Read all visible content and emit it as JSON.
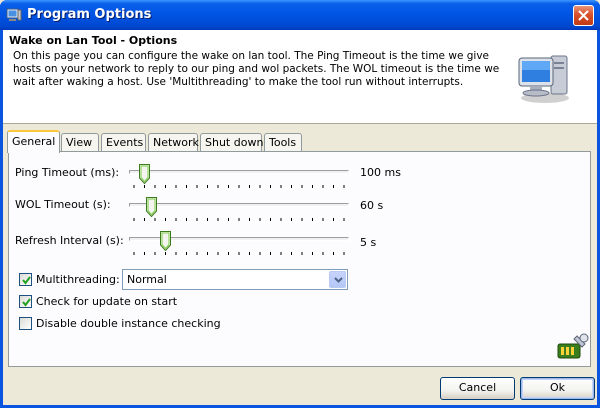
{
  "window": {
    "title": "Program Options"
  },
  "header": {
    "title": "Wake on Lan Tool - Options",
    "description": "On this page you can configure the wake on lan tool. The Ping Timeout is the time we give hosts on your network to reply to our ping and wol packets. The WOL timeout is the time we wait after waking a host. Use 'Multithreading' to make the tool run without interrupts."
  },
  "tabs": [
    {
      "label": "General",
      "active": true
    },
    {
      "label": "View"
    },
    {
      "label": "Events"
    },
    {
      "label": "Network"
    },
    {
      "label": "Shut down"
    },
    {
      "label": "Tools"
    }
  ],
  "settings": {
    "ping_timeout": {
      "label": "Ping Timeout (ms):",
      "value": "100 ms",
      "level": 0.05
    },
    "wol_timeout": {
      "label": "WOL Timeout (s):",
      "value": "60 s",
      "level": 0.08
    },
    "refresh_interval": {
      "label": "Refresh Interval (s):",
      "value": "5 s",
      "level": 0.15
    },
    "multithreading": {
      "label": "Multithreading:",
      "checked": true,
      "selected": "Normal"
    },
    "check_update": {
      "label": "Check for update on start",
      "checked": true
    },
    "disable_double": {
      "label": "Disable double instance checking",
      "checked": false
    }
  },
  "buttons": {
    "cancel": "Cancel",
    "ok": "Ok"
  },
  "colors": {
    "titlebar": "#0054e3",
    "tab_highlight": "#ffc83c",
    "face": "#ece9d8"
  }
}
